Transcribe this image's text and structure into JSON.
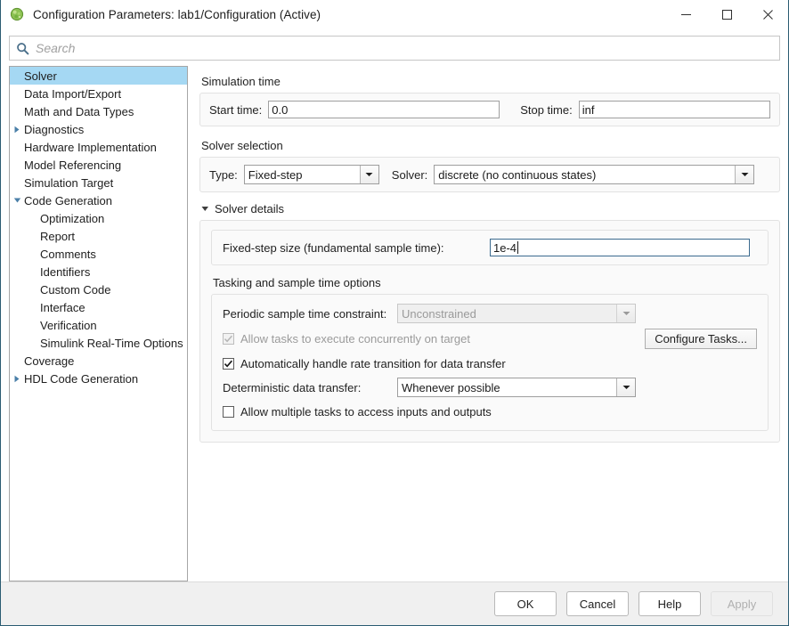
{
  "window": {
    "title": "Configuration Parameters: lab1/Configuration (Active)",
    "icon": "simulink-icon",
    "minimize_label": "–",
    "maximize_label": "□",
    "close_label": "✕"
  },
  "search": {
    "placeholder": "Search",
    "value": "",
    "icon": "search-icon"
  },
  "tree": {
    "items": [
      {
        "label": "Solver",
        "indent": 0,
        "arrow": "none",
        "selected": true
      },
      {
        "label": "Data Import/Export",
        "indent": 0,
        "arrow": "none",
        "selected": false
      },
      {
        "label": "Math and Data Types",
        "indent": 0,
        "arrow": "none",
        "selected": false
      },
      {
        "label": "Diagnostics",
        "indent": 0,
        "arrow": "collapsed",
        "selected": false
      },
      {
        "label": "Hardware Implementation",
        "indent": 0,
        "arrow": "none",
        "selected": false
      },
      {
        "label": "Model Referencing",
        "indent": 0,
        "arrow": "none",
        "selected": false
      },
      {
        "label": "Simulation Target",
        "indent": 0,
        "arrow": "none",
        "selected": false
      },
      {
        "label": "Code Generation",
        "indent": 0,
        "arrow": "expanded",
        "selected": false
      },
      {
        "label": "Optimization",
        "indent": 1,
        "arrow": "none",
        "selected": false
      },
      {
        "label": "Report",
        "indent": 1,
        "arrow": "none",
        "selected": false
      },
      {
        "label": "Comments",
        "indent": 1,
        "arrow": "none",
        "selected": false
      },
      {
        "label": "Identifiers",
        "indent": 1,
        "arrow": "none",
        "selected": false
      },
      {
        "label": "Custom Code",
        "indent": 1,
        "arrow": "none",
        "selected": false
      },
      {
        "label": "Interface",
        "indent": 1,
        "arrow": "none",
        "selected": false
      },
      {
        "label": "Verification",
        "indent": 1,
        "arrow": "none",
        "selected": false
      },
      {
        "label": "Simulink Real-Time Options",
        "indent": 1,
        "arrow": "none",
        "selected": false
      },
      {
        "label": "Coverage",
        "indent": 0,
        "arrow": "none",
        "selected": false
      },
      {
        "label": "HDL Code Generation",
        "indent": 0,
        "arrow": "collapsed",
        "selected": false
      }
    ]
  },
  "panel": {
    "simulation_time": {
      "heading": "Simulation time",
      "start_label": "Start time:",
      "start_value": "0.0",
      "stop_label": "Stop time:",
      "stop_value": "inf"
    },
    "solver_selection": {
      "heading": "Solver selection",
      "type_label": "Type:",
      "type_value": "Fixed-step",
      "solver_label": "Solver:",
      "solver_value": "discrete (no continuous states)"
    },
    "solver_details": {
      "heading": "Solver details",
      "expanded": true,
      "fixed_step_label": "Fixed-step size (fundamental sample time):",
      "fixed_step_value": "1e-4",
      "tasking_heading": "Tasking and sample time options",
      "periodic_label": "Periodic sample time constraint:",
      "periodic_value": "Unconstrained",
      "periodic_enabled": false,
      "allow_concurrent_label": "Allow tasks to execute concurrently on target",
      "allow_concurrent_checked": true,
      "allow_concurrent_enabled": false,
      "configure_tasks_label": "Configure Tasks...",
      "auto_rate_label": "Automatically handle rate transition for data transfer",
      "auto_rate_checked": true,
      "deterministic_label": "Deterministic data transfer:",
      "deterministic_value": "Whenever possible",
      "multitask_label": "Allow multiple tasks to access inputs and outputs",
      "multitask_checked": false
    }
  },
  "footer": {
    "ok_label": "OK",
    "cancel_label": "Cancel",
    "help_label": "Help",
    "apply_label": "Apply",
    "apply_enabled": false
  },
  "colors": {
    "selection_blue": "#a5d8f3",
    "window_border": "#2b5c72",
    "focus_border": "#3b6b8f",
    "icon_green": "#6aa84f"
  }
}
